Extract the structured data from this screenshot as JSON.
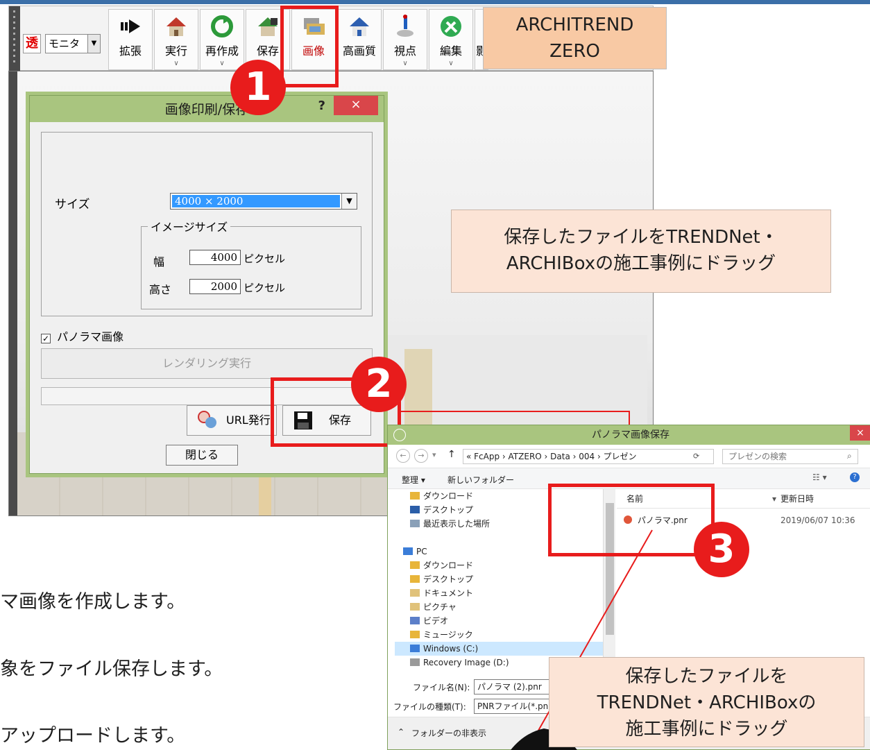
{
  "toolbar": {
    "tou": "透",
    "monitor": "モニタ",
    "buttons": [
      {
        "label": "拡張",
        "icon": "arrow-icon"
      },
      {
        "label": "実行",
        "icon": "house-icon"
      },
      {
        "label": "再作成",
        "icon": "refresh-icon"
      },
      {
        "label": "保存",
        "icon": "house-save-icon"
      },
      {
        "label": "画像",
        "icon": "printer-image-icon"
      },
      {
        "label": "高画質",
        "icon": "house-hq-icon"
      },
      {
        "label": "視点",
        "icon": "person-pin-icon"
      },
      {
        "label": "編集",
        "icon": "tools-icon"
      },
      {
        "label": "影",
        "icon": "shadow-icon"
      }
    ]
  },
  "product": {
    "line1": "ARCHITREND",
    "line2": "ZERO"
  },
  "dialog": {
    "title": "画像印刷/保存",
    "help": "?",
    "close": "×",
    "size_label": "サイズ",
    "size_value": "4000 × 2000",
    "image_size_group": "イメージサイズ",
    "width_label": "幅",
    "width_value": "4000",
    "height_label": "高さ",
    "height_value": "2000",
    "unit": "ピクセル",
    "panorama_label": "パノラマ画像",
    "panorama_checked": "✓",
    "render_button": "レンダリング実行",
    "url_button": "URL発行",
    "save_button": "保存",
    "close_button": "閉じる"
  },
  "callout_top": {
    "line1": "保存したファイルをTRENDNet・",
    "line2": "ARCHIBoxの施工事例にドラッグ"
  },
  "badges": {
    "one": "1",
    "two": "2",
    "three": "3"
  },
  "save_dialog": {
    "title": "パノラマ画像保存",
    "close": "×",
    "path": "« FcApp › ATZERO › Data › 004 › プレゼン",
    "search_placeholder": "プレゼンの検索",
    "organize": "整理 ▾",
    "new_folder": "新しいフォルダー",
    "tree": [
      {
        "label": "ダウンロード",
        "icon": "download-folder-icon"
      },
      {
        "label": "デスクトップ",
        "icon": "desktop-icon"
      },
      {
        "label": "最近表示した場所",
        "icon": "recent-icon"
      },
      {
        "label": "",
        "icon": ""
      },
      {
        "label": "PC",
        "icon": "pc-icon"
      },
      {
        "label": "ダウンロード",
        "icon": "download-folder-icon"
      },
      {
        "label": "デスクトップ",
        "icon": "desktop-folder-icon"
      },
      {
        "label": "ドキュメント",
        "icon": "documents-icon"
      },
      {
        "label": "ピクチャ",
        "icon": "pictures-icon"
      },
      {
        "label": "ビデオ",
        "icon": "videos-icon"
      },
      {
        "label": "ミュージック",
        "icon": "music-icon"
      },
      {
        "label": "Windows (C:)",
        "icon": "drive-icon"
      },
      {
        "label": "Recovery Image (D:)",
        "icon": "drive-icon"
      }
    ],
    "col_name": "名前",
    "col_date": "更新日時",
    "file_name": "パノラマ.pnr",
    "file_date": "2019/06/07 10:36",
    "filename_label": "ファイル名(N):",
    "filename_value": "パノラマ (2).pnr",
    "filetype_label": "ファイルの種類(T):",
    "filetype_value": "PNRファイル(*.pnr)",
    "hide_folders": "フォルダーの非表示"
  },
  "callout_bottom": {
    "line1": "保存したファイルを",
    "line2": "TRENDNet・ARCHIBoxの",
    "line3": "施工事例にドラッグ"
  },
  "steps": {
    "s1": "マ画像を作成します。",
    "s2": "象をファイル保存します。",
    "s3": "アップロードします。"
  }
}
